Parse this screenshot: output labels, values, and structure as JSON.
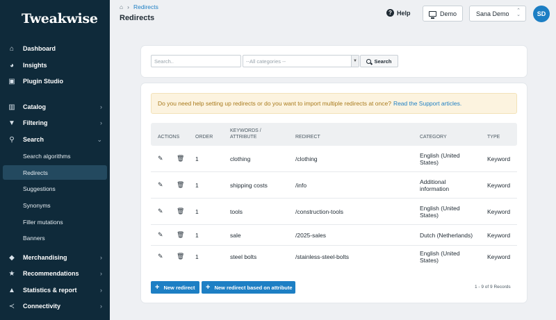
{
  "sidebar": {
    "logo": "Tweakwise",
    "items_top": [
      {
        "label": "Dashboard",
        "icon": "home-icon"
      },
      {
        "label": "Insights",
        "icon": "pie-chart-icon"
      },
      {
        "label": "Plugin Studio",
        "icon": "plugin-icon"
      }
    ],
    "items_main": [
      {
        "label": "Catalog",
        "icon": "book-icon"
      },
      {
        "label": "Filtering",
        "icon": "filter-icon"
      },
      {
        "label": "Search",
        "icon": "search-icon"
      }
    ],
    "search_sub": [
      "Search algorithms",
      "Redirects",
      "Suggestions",
      "Synonyms",
      "Filler mutations",
      "Banners"
    ],
    "items_bottom": [
      {
        "label": "Merchandising",
        "icon": "tag-icon"
      },
      {
        "label": "Recommendations",
        "icon": "star-icon"
      },
      {
        "label": "Statistics & report",
        "icon": "chart-icon"
      },
      {
        "label": "Connectivity",
        "icon": "share-icon"
      }
    ]
  },
  "breadcrumb": {
    "current": "Redirects"
  },
  "page_title": "Redirects",
  "topbar": {
    "help_label": "Help",
    "demo_label": "Demo",
    "shop_select": "Sana Demo",
    "avatar_initials": "SD"
  },
  "search": {
    "placeholder": "Search..",
    "category_placeholder": "--All categories --",
    "button_label": "Search"
  },
  "alert": {
    "text": "Do you need help setting up redirects or do you want to import multiple redirects at once?",
    "link": "Read the Support articles."
  },
  "table": {
    "headers": {
      "actions": "Actions",
      "order": "Order",
      "keywords1": "Keywords /",
      "keywords2": "Attribute",
      "redirect": "Redirect",
      "category": "Category",
      "type": "Type"
    },
    "rows": [
      {
        "order": "1",
        "keyword": "clothing",
        "redirect": "/clothing",
        "category1": "English (United",
        "category2": "States)",
        "type": "Keyword"
      },
      {
        "order": "1",
        "keyword": "shipping costs",
        "redirect": "/info",
        "category1": "Additional",
        "category2": "information",
        "type": "Keyword"
      },
      {
        "order": "1",
        "keyword": "tools",
        "redirect": "/construction-tools",
        "category1": "English (United",
        "category2": "States)",
        "type": "Keyword"
      },
      {
        "order": "1",
        "keyword": "sale",
        "redirect": "/2025-sales",
        "category1": "Dutch (Netherlands)",
        "category2": "",
        "type": "Keyword"
      },
      {
        "order": "1",
        "keyword": "steel bolts",
        "redirect": "/stainless-steel-bolts",
        "category1": "English (United",
        "category2": "States)",
        "type": "Keyword"
      }
    ]
  },
  "footer": {
    "new_redirect": "New redirect",
    "new_redirect_attr": "New redirect based on attribute",
    "records": "1 - 9 of 9 Records"
  },
  "colors": {
    "sidebar": "#0f2a3a",
    "accent": "#1d7fc4",
    "alert_bg": "#fcf3df"
  }
}
